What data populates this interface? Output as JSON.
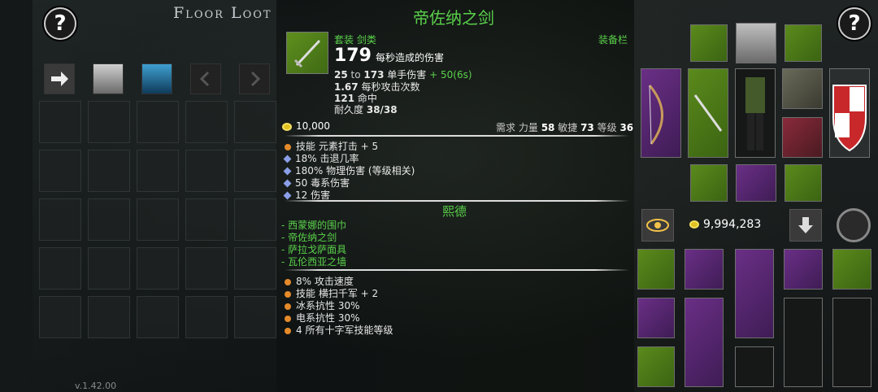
{
  "header": {
    "floor_title": "Floor Loot",
    "help_symbol": "?"
  },
  "version": "v.1.42.00",
  "item": {
    "name": "帝佐纳之剑",
    "type_line": "套装 剑类",
    "equip_tag": "装备栏",
    "dps": "179",
    "dps_label": "每秒造成的伤害",
    "damage_min": "25",
    "damage_to": "to",
    "damage_max": "173",
    "damage_label": "单手伤害",
    "damage_bonus": "+ 50(6s)",
    "attack_speed": "1.67",
    "attack_speed_label": "每秒攻击次数",
    "accuracy": "121",
    "accuracy_label": "命中",
    "durability_label": "耐久度",
    "durability": "38/38",
    "price": "10,000",
    "req_label": "需求",
    "req_str_label": "力量",
    "req_str": "58",
    "req_dex_label": "敏捷",
    "req_dex": "73",
    "req_level_label": "等级",
    "req_level": "36",
    "affixes": [
      {
        "bullet": "orange",
        "text": "技能 元素打击 + 5"
      },
      {
        "bullet": "blue",
        "text": "18% 击退几率"
      },
      {
        "bullet": "blue",
        "text": "180% 物理伤害 (等级相关)"
      },
      {
        "bullet": "blue",
        "text": "50 毒系伤害"
      },
      {
        "bullet": "blue",
        "text": "12 伤害"
      }
    ],
    "set_name": "熙德",
    "set_items": [
      "- 西蒙娜的围巾",
      "- 帝佐纳之剑",
      "- 萨拉戈萨面具",
      "- 瓦伦西亚之墙"
    ],
    "set_bonuses": [
      {
        "bullet": "orange",
        "text": "8% 攻击速度"
      },
      {
        "bullet": "orange",
        "text": "技能 横扫千军 + 2"
      },
      {
        "bullet": "orange",
        "text": "冰系抗性 30%"
      },
      {
        "bullet": "orange",
        "text": "电系抗性 30%"
      },
      {
        "bullet": "orange",
        "text": "4 所有十字军技能等级"
      }
    ]
  },
  "inventory": {
    "gold": "9,994,283"
  },
  "colors": {
    "set_green": "#5ad14a",
    "rare_purple": "#6a2f86",
    "magic_green": "#5b8a1c",
    "affix_orange": "#e48a2a",
    "affix_blue": "#8a9ee8"
  }
}
